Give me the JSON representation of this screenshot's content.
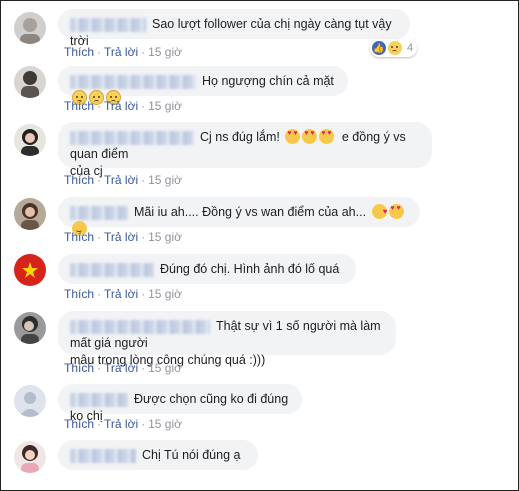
{
  "actions": {
    "like": "Thích",
    "reply": "Trả lời",
    "separator": "·"
  },
  "colors": {
    "link": "#385898",
    "bubble": "#f2f3f5",
    "meta": "#90949c"
  },
  "comments": [
    {
      "text": "Sao lượt follower của chị ngày càng tụt vậy trời",
      "time": "15 giờ",
      "reaction_count": "4",
      "reactions": [
        "like-icon",
        "sad-icon"
      ]
    },
    {
      "text": "Họ ngượng chín cả mặt",
      "time": "15 giờ",
      "emojis": [
        "sad-face",
        "sad-face",
        "sad-face"
      ]
    },
    {
      "text": "Cj ns đúg lắm!",
      "text2": "e đồng ý vs quan điểm",
      "text3": "của cj",
      "time": "15 giờ",
      "emojis": [
        "heart-eyes",
        "heart-eyes",
        "heart-eyes"
      ]
    },
    {
      "text": "Mãi iu ah.... Đồng ý vs wan điểm của ah...",
      "time": "15 giờ",
      "emojis": [
        "kiss-face",
        "heart-eyes",
        "smile-face"
      ]
    },
    {
      "text": "Đúng đó chị. Hình ảnh đó lố quá",
      "time": "15 giờ"
    },
    {
      "text": "Thật sự vì 1 số người mà làm mất giá người",
      "text2": "mâu trong lòng công chúng quá :)))",
      "time": "15 giờ"
    },
    {
      "text": "Được chọn cũng ko đi đúng ko chị",
      "time": "15 giờ"
    },
    {
      "text": "Chị Tú nói đúng ạ"
    }
  ]
}
